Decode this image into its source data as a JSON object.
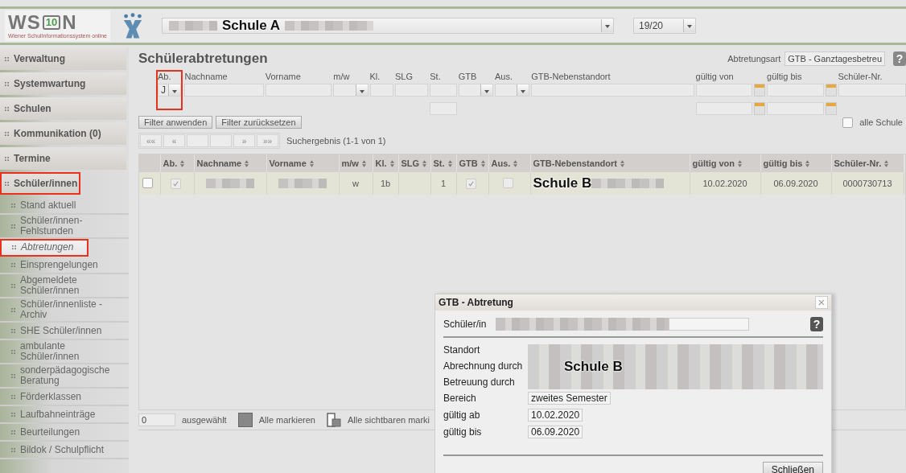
{
  "header": {
    "logo": {
      "mark": "WS",
      "badge": "10",
      "end": "N",
      "tagline": "Wiener SchulInformationssystem online"
    },
    "school_select": {
      "overlay_label": "Schule A"
    },
    "year_select": {
      "value": "19/20"
    }
  },
  "sidebar": {
    "items": [
      {
        "label": "Verwaltung",
        "highlighted": false
      },
      {
        "label": "Systemwartung",
        "highlighted": false
      },
      {
        "label": "Schulen",
        "highlighted": false
      },
      {
        "label": "Kommunikation (0)",
        "highlighted": false
      },
      {
        "label": "Termine",
        "highlighted": false
      },
      {
        "label": "Schüler/innen",
        "highlighted": true,
        "children": [
          {
            "label": "Stand aktuell",
            "selected": false,
            "highlighted": false
          },
          {
            "label": "Schüler/innen-Fehlstunden",
            "selected": false,
            "highlighted": false
          },
          {
            "label": "Abtretungen",
            "selected": true,
            "highlighted": true
          },
          {
            "label": "Einsprengelungen",
            "selected": false,
            "highlighted": false
          },
          {
            "label": "Abgemeldete Schüler/innen",
            "selected": false,
            "highlighted": false
          },
          {
            "label": "Schüler/innenliste - Archiv",
            "selected": false,
            "highlighted": false
          },
          {
            "label": "SHE Schüler/innen",
            "selected": false,
            "highlighted": false
          },
          {
            "label": "ambulante Schüler/innen",
            "selected": false,
            "highlighted": false
          },
          {
            "label": "sonderpädagogische Beratung",
            "selected": false,
            "highlighted": false
          },
          {
            "label": "Förderklassen",
            "selected": false,
            "highlighted": false
          },
          {
            "label": "Laufbahneinträge",
            "selected": false,
            "highlighted": false
          },
          {
            "label": "Beurteilungen",
            "selected": false,
            "highlighted": false
          },
          {
            "label": "Bildok / Schulpflicht",
            "selected": false,
            "highlighted": false
          }
        ]
      }
    ]
  },
  "main": {
    "title": "Schülerabtretungen",
    "type_label": "Abtretungsart",
    "type_value": "GTB - Ganztagesbetreu",
    "help_icon": "?",
    "filters": [
      {
        "label": "Ab.",
        "kind": "select",
        "value": "J",
        "highlighted": true
      },
      {
        "label": "Nachname",
        "kind": "text",
        "highlighted": false
      },
      {
        "label": "Vorname",
        "kind": "text",
        "highlighted": false
      },
      {
        "label": "m/w",
        "kind": "select",
        "highlighted": false
      },
      {
        "label": "Kl.",
        "kind": "text",
        "highlighted": false
      },
      {
        "label": "SLG",
        "kind": "text",
        "highlighted": false
      },
      {
        "label": "St.",
        "kind": "text2",
        "highlighted": false
      },
      {
        "label": "GTB",
        "kind": "select",
        "highlighted": false
      },
      {
        "label": "Aus.",
        "kind": "select",
        "highlighted": false
      },
      {
        "label": "GTB-Nebenstandort",
        "kind": "text",
        "highlighted": false
      },
      {
        "label": "gültig von",
        "kind": "date",
        "highlighted": false
      },
      {
        "label": "gültig bis",
        "kind": "date",
        "highlighted": false
      },
      {
        "label": "Schüler-Nr.",
        "kind": "text",
        "highlighted": false
      }
    ],
    "all_schools": {
      "label": "alle Schule",
      "checked": false
    },
    "buttons": [
      "Filter anwenden",
      "Filter zurücksetzen"
    ],
    "pager": {
      "buttons": [
        "««",
        "«",
        "»",
        "»»"
      ],
      "result": "Suchergebnis (1-1 von 1)"
    },
    "table": {
      "columns": [
        "Ab.",
        "Nachname",
        "Vorname",
        "m/w",
        "Kl.",
        "SLG",
        "St.",
        "GTB",
        "Aus.",
        "GTB-Nebenstandort",
        "gültig von",
        "gültig bis",
        "Schüler-Nr."
      ],
      "rows": [
        {
          "selected": false,
          "cells": [
            {
              "kind": "check",
              "checked": true
            },
            {
              "kind": "redacted"
            },
            {
              "kind": "redacted"
            },
            {
              "kind": "text",
              "text": "w"
            },
            {
              "kind": "text",
              "text": "1b"
            },
            {
              "kind": "text",
              "text": ""
            },
            {
              "kind": "text",
              "text": "1"
            },
            {
              "kind": "check",
              "checked": true
            },
            {
              "kind": "check",
              "checked": false
            },
            {
              "kind": "label",
              "text": "Schule B"
            },
            {
              "kind": "text",
              "text": "10.02.2020"
            },
            {
              "kind": "text",
              "text": "06.09.2020"
            },
            {
              "kind": "text",
              "text": "0000730713"
            }
          ]
        }
      ]
    },
    "footer": {
      "count": "0",
      "selected_label": "ausgewählt",
      "mark_all": "Alle markieren",
      "mark_visible": "Alle sichtbaren marki"
    }
  },
  "dialog": {
    "title": "GTB - Abtretung",
    "close_icon": "×",
    "help_icon": "?",
    "student_label": "Schüler/in",
    "location_labels": [
      "Standort",
      "Abrechnung durch",
      "Betreuung durch"
    ],
    "location_overlay": "Schule B",
    "fields": [
      {
        "label": "Bereich",
        "value": "zweites Semester"
      },
      {
        "label": "gültig ab",
        "value": "10.02.2020"
      },
      {
        "label": "gültig bis",
        "value": "06.09.2020"
      }
    ],
    "close_button": "Schließen"
  }
}
